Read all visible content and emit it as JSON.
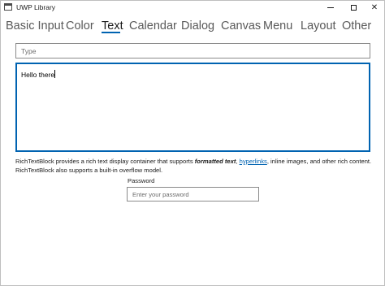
{
  "window": {
    "title": "UWP Library",
    "minimize_glyph": "—",
    "maximize_glyph": "☐",
    "close_glyph": "✕"
  },
  "nav": {
    "tabs": [
      {
        "label": "Basic Input",
        "active": false
      },
      {
        "label": "Color",
        "active": false
      },
      {
        "label": "Text",
        "active": true
      },
      {
        "label": "Calendar",
        "active": false
      },
      {
        "label": "Dialog",
        "active": false
      },
      {
        "label": "Canvas",
        "active": false
      },
      {
        "label": "Menu",
        "active": false
      },
      {
        "label": "Layout",
        "active": false
      },
      {
        "label": "Other",
        "active": false
      }
    ]
  },
  "type_input": {
    "placeholder": "Type",
    "value": ""
  },
  "multiline_text": {
    "value": "Hello there"
  },
  "rich_text": {
    "part1": "RichTextBlock provides a rich text display container that supports ",
    "bold_italic": "formatted text",
    "part2": ", ",
    "link": "hyperlinks",
    "part3": ", inline images, and other rich content. RichTextBlock also supports a built-in overflow model."
  },
  "password": {
    "label": "Password",
    "placeholder": "Enter your password",
    "value": ""
  },
  "colors": {
    "accent": "#0063b1",
    "inactive_tab": "#595959",
    "border": "#8a8a8a"
  }
}
